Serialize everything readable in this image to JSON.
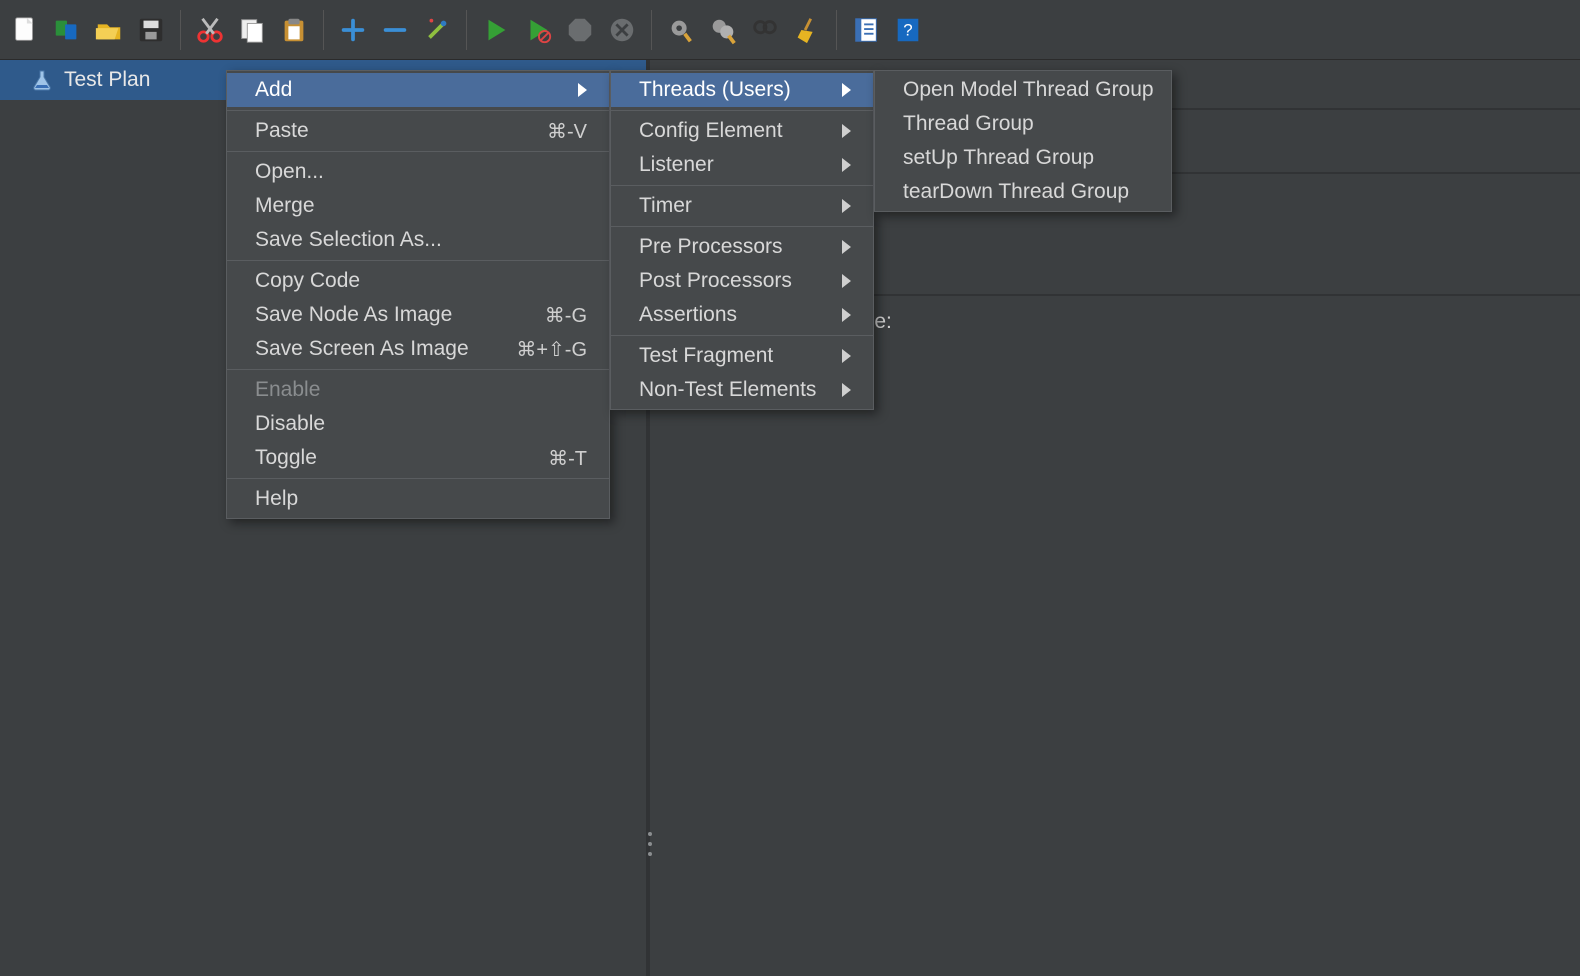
{
  "toolbar": {
    "icons": [
      "new-file-icon",
      "templates-icon",
      "open-icon",
      "save-icon",
      "sep",
      "cut-icon",
      "copy-icon",
      "paste-icon",
      "sep",
      "plus-icon",
      "minus-icon",
      "wand-icon",
      "sep",
      "run-icon",
      "run-no-timer-icon",
      "stop-icon",
      "shutdown-icon",
      "sep",
      "gear-clean-icon",
      "gear-clean-all-icon",
      "search-icon",
      "broom-icon",
      "sep",
      "function-helper-icon",
      "help-icon"
    ]
  },
  "tree": {
    "root_label": "Test Plan"
  },
  "form": {
    "name_label": "Name:"
  },
  "context_menu": {
    "items": [
      {
        "label": "Add",
        "submenu": true,
        "highlight": true
      },
      {
        "sep": true
      },
      {
        "label": "Paste",
        "shortcut": "⌘-V"
      },
      {
        "sep": true
      },
      {
        "label": "Open..."
      },
      {
        "label": "Merge"
      },
      {
        "label": "Save Selection As..."
      },
      {
        "sep": true
      },
      {
        "label": "Copy Code"
      },
      {
        "label": "Save Node As Image",
        "shortcut": "⌘-G"
      },
      {
        "label": "Save Screen As Image",
        "shortcut": "⌘+⇧-G"
      },
      {
        "sep": true
      },
      {
        "label": "Enable",
        "disabled": true
      },
      {
        "label": "Disable"
      },
      {
        "label": "Toggle",
        "shortcut": "⌘-T"
      },
      {
        "sep": true
      },
      {
        "label": "Help"
      }
    ]
  },
  "add_submenu": {
    "items": [
      {
        "label": "Threads (Users)",
        "submenu": true,
        "highlight": true
      },
      {
        "sep": true
      },
      {
        "label": "Config Element",
        "submenu": true
      },
      {
        "label": "Listener",
        "submenu": true
      },
      {
        "sep": true
      },
      {
        "label": "Timer",
        "submenu": true
      },
      {
        "sep": true
      },
      {
        "label": "Pre Processors",
        "submenu": true
      },
      {
        "label": "Post Processors",
        "submenu": true
      },
      {
        "label": "Assertions",
        "submenu": true
      },
      {
        "sep": true
      },
      {
        "label": "Test Fragment",
        "submenu": true
      },
      {
        "label": "Non-Test Elements",
        "submenu": true
      }
    ]
  },
  "threads_submenu": {
    "items": [
      {
        "label": "Open Model Thread Group"
      },
      {
        "label": "Thread Group"
      },
      {
        "label": "setUp Thread Group"
      },
      {
        "label": "tearDown Thread Group"
      }
    ]
  }
}
